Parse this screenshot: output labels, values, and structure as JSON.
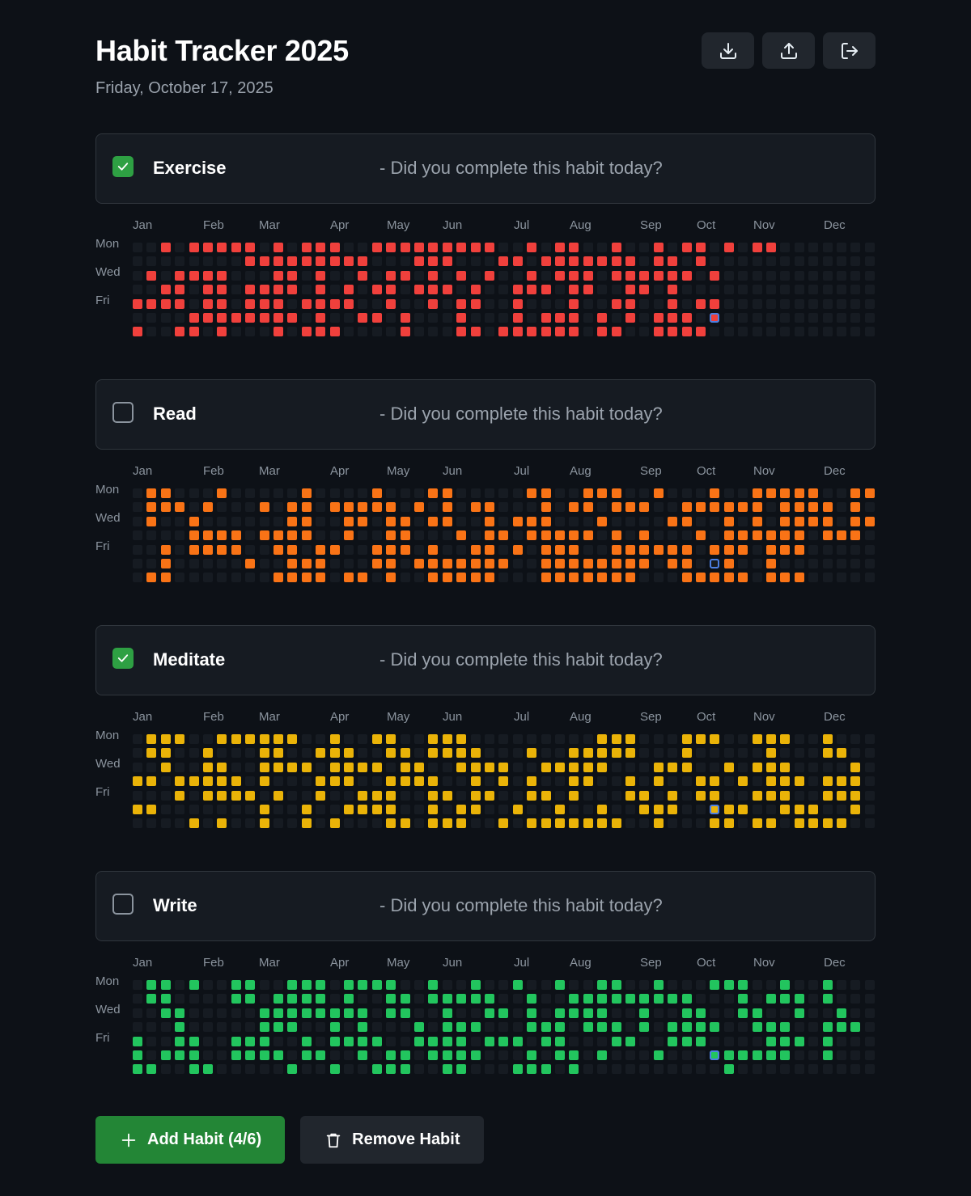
{
  "app": {
    "title": "Habit Tracker 2025",
    "date": "Friday, October 17, 2025"
  },
  "header_actions": [
    {
      "name": "download-button",
      "icon": "download-icon"
    },
    {
      "name": "upload-button",
      "icon": "upload-icon"
    },
    {
      "name": "logout-button",
      "icon": "logout-icon"
    }
  ],
  "months": [
    "Jan",
    "Feb",
    "Mar",
    "Apr",
    "May",
    "Jun",
    "Jul",
    "Aug",
    "Sep",
    "Oct",
    "Nov",
    "Dec"
  ],
  "day_labels": [
    "Mon",
    "Wed",
    "Fri"
  ],
  "habit_question": "- Did you complete this habit today?",
  "empty_color": "#161b22",
  "today_outline_color": "#4c7fe3",
  "habits": [
    {
      "name": "Exercise",
      "checked": true,
      "color": "#f0403c",
      "grid": [
        "..x.xxxxx.x.xxx..xxxxxxxxx..x.xx..x..x.xx.x.xx",
        "........xxxxxxxxx...xxx...xx.xxxxxxx.xx.x",
        ".x.xxxx...xx.x..x.xx.x.x.x..x.xxx.xxxxxx.x",
        "..xx.xx.xxxx.x.x.xx.xxx.x..xxx.xx..xx.x",
        "xxxx.xx.xxx.xxxx..x..x.xx..x...x..xx..x.xx",
        "....xxxxxxxx.x..xx.x...x...x.xxx.x.x.xxx",
        "x..xx.x...x.xxx....x...xx.xxxxxx.xx..xxxx"
      ]
    },
    {
      "name": "Read",
      "checked": false,
      "color": "#f97316",
      "grid": [
        ".xx...x.....x....x...xx.....xx..xxx..x...x..xxxxx..xx",
        ".xxx.x...x.xx.xxxxx.x.x.xx...x.xx.xxx..xxxxxx.xxxx.x",
        ".x..x......xx..xx.xx.xx..x.xxx...x....xx..x.x.xxxx.xx",
        "....xxxx.xxxx..x..xx...x.xx.xxxxx.x.x...x.xxxxxx.xxx",
        "..x.xxxx..xx.xx..xxx.x..xx.x.xxx..xxxxxx.xxx.xxx",
        "..x.....x..xxx...xx.xxxxxxx..xxxxxxxx.xx..x..x",
        ".xx.......xxxx.xx.x..xxxxx...xxxxxxx...xxxxx.xxx"
      ]
    },
    {
      "name": "Meditate",
      "checked": true,
      "color": "#eab308",
      "grid": [
        ".xxx..xxxxxx..x..xx..xxx.........xxx...xxx..xxx..x",
        ".xx..x...xx..xxx..xx.xxxx...x..xxxxx...x.....x...xx.",
        "..x..xx..xxxx.xxxx.xx..xxxx..xxxxx...xxx..x.xxx....x",
        "xx.xxxxx.x...xxx..xxxx..x.x.x..xx..x.x..xx.x.xxx.xxx",
        "...x.xxxx.x..x..xxx..xx.xx..xx.x...xx.x.xx..xxx..xxx",
        "xx.......x..x..xxxx..x.xx..x..x..x..xxx..xxx..xxx..x",
        "....x.x..x..x.x...xx.xxx..x.xxxxxxx..x...xx.xx.xxxx."
      ]
    },
    {
      "name": "Write",
      "checked": false,
      "color": "#22c55e",
      "grid": [
        ".xx.x..xx..xxx.xxxx..x..x..x..x..xx..x...xxx..x..x",
        ".xx....xx.xxxx.x..xx.xxxxx..x..xxxxxxxxx...x.xxx.x",
        "..xx.....xxxxxxxx.xx..x..xx.x.xxxx..x..xx..xx..x..x",
        "...x.....xxx..x.x...x.xxx...xxx.xxx.x.xxxx..xxx..xxx",
        "x..xx..xxx..x.xxxx..xxxx.xxx.xx...xx..xxx....xxx.x",
        "x.xxx..xxxx.xx..x.xx.xxxx...x.xx.x...x...xxxxxx..x",
        "xx..xx.....x..x..xxx..xx...xxx.x..........x"
      ]
    }
  ],
  "today": {
    "week": 41,
    "day": 5
  },
  "buttons": {
    "add_habit": "Add Habit (4/6)",
    "remove_habit": "Remove Habit"
  },
  "colors": {
    "background": "#0d1117",
    "card": "#161b22",
    "border": "#30363d",
    "primary_button": "#238636",
    "secondary_button": "#21262d",
    "checkbox_checked": "#2ea043"
  }
}
